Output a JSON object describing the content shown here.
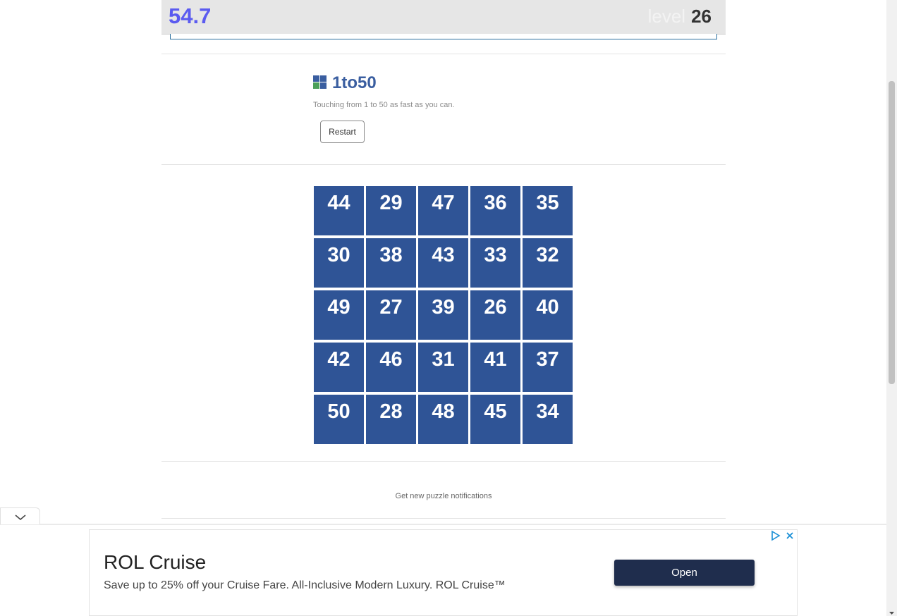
{
  "header": {
    "timer": "54.7",
    "level_label": "level",
    "level_value": "26"
  },
  "game": {
    "title": "1to50",
    "subtitle": "Touching from 1 to 50 as fast as you can.",
    "restart_label": "Restart",
    "grid": [
      [
        "44",
        "29",
        "47",
        "36",
        "35"
      ],
      [
        "30",
        "38",
        "43",
        "33",
        "32"
      ],
      [
        "49",
        "27",
        "39",
        "26",
        "40"
      ],
      [
        "42",
        "46",
        "31",
        "41",
        "37"
      ],
      [
        "50",
        "28",
        "48",
        "45",
        "34"
      ]
    ],
    "tile_color": "#2f5496"
  },
  "notifications": {
    "text": "Get new puzzle notifications"
  },
  "ad": {
    "title": "ROL Cruise",
    "text": "Save up to 25% off your Cruise Fare. All-Inclusive Modern Luxury. ROL Cruise™",
    "button_label": "Open",
    "icons": [
      "adchoices-icon",
      "close-icon"
    ]
  },
  "colors": {
    "accent_timer": "#5b5bf0",
    "title": "#3a5ea0",
    "ad_button": "#1f2d4d"
  }
}
